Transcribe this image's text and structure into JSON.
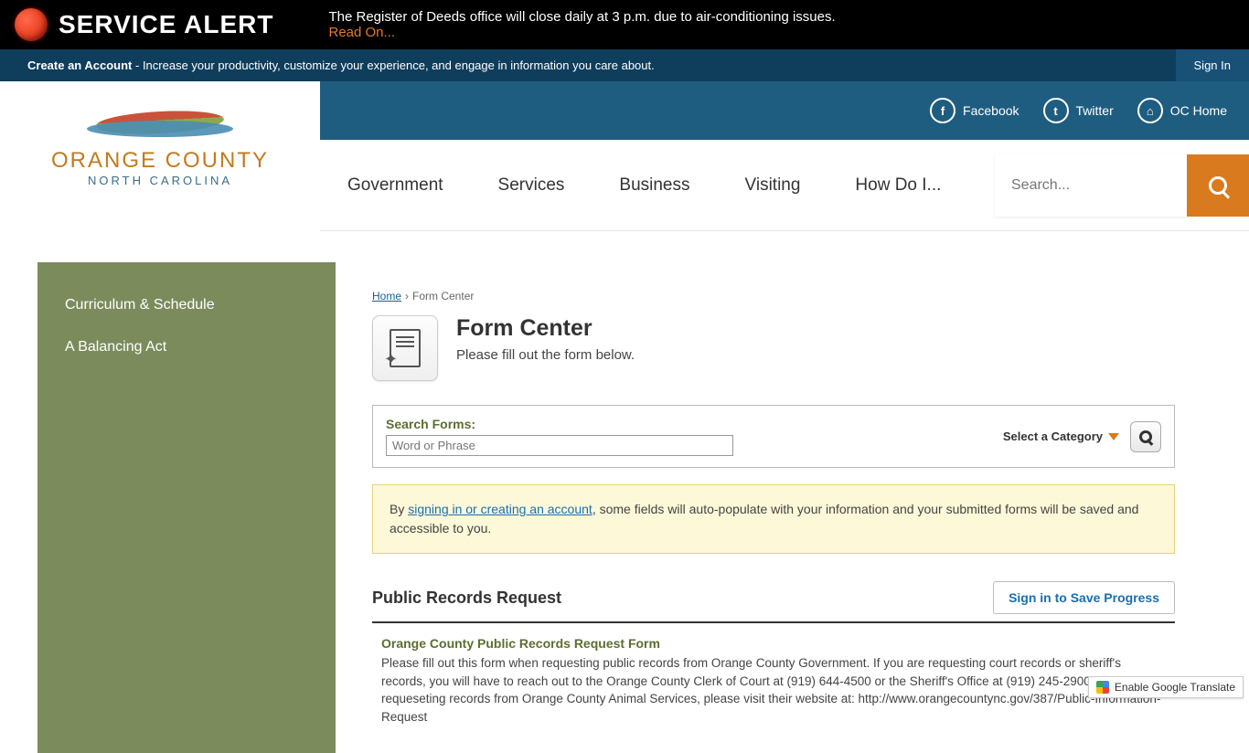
{
  "alert": {
    "title": "SERVICE ALERT",
    "body": "The Register of Deeds office will close daily at 3 p.m. due to air-conditioning issues.",
    "read_on": "Read On..."
  },
  "signin": {
    "create": "Create an Account",
    "desc": " - Increase your productivity, customize your experience, and engage in information you care about.",
    "button": "Sign In"
  },
  "logo": {
    "line1": "ORANGE COUNTY",
    "line2": "NORTH CAROLINA"
  },
  "social": [
    {
      "glyph": "f",
      "label": "Facebook"
    },
    {
      "glyph": "t",
      "label": "Twitter"
    },
    {
      "glyph": "⌂",
      "label": "OC Home"
    }
  ],
  "nav": [
    "Government",
    "Services",
    "Business",
    "Visiting",
    "How Do I..."
  ],
  "search_placeholder": "Search...",
  "sidebar": [
    "Curriculum & Schedule",
    "A Balancing Act"
  ],
  "breadcrumb": {
    "home": "Home",
    "current": "Form Center"
  },
  "page": {
    "title": "Form Center",
    "sub": "Please fill out the form below."
  },
  "search_forms": {
    "label": "Search Forms:",
    "placeholder": "Word or Phrase",
    "category": "Select a Category"
  },
  "info": {
    "prefix": "By ",
    "link": "signing in or creating an account",
    "suffix": ", some fields will auto-populate with your information and your submitted forms will be saved and accessible to you."
  },
  "form": {
    "title": "Public Records Request",
    "save": "Sign in to Save Progress",
    "subhead": "Orange County Public Records Request Form",
    "desc": "Please fill out this form when requesting public records from Orange County Government. If you are requesting court records or sheriff's records, you will have to reach out to the Orange County Clerk of Court at (919) 644-4500 or the Sheriff's Office at (919) 245-2900. If you are requeseting records from Orange County Animal Services, please visit their website at: http://www.orangecountync.gov/387/Public-Information-Request"
  },
  "translate": "Enable Google Translate"
}
